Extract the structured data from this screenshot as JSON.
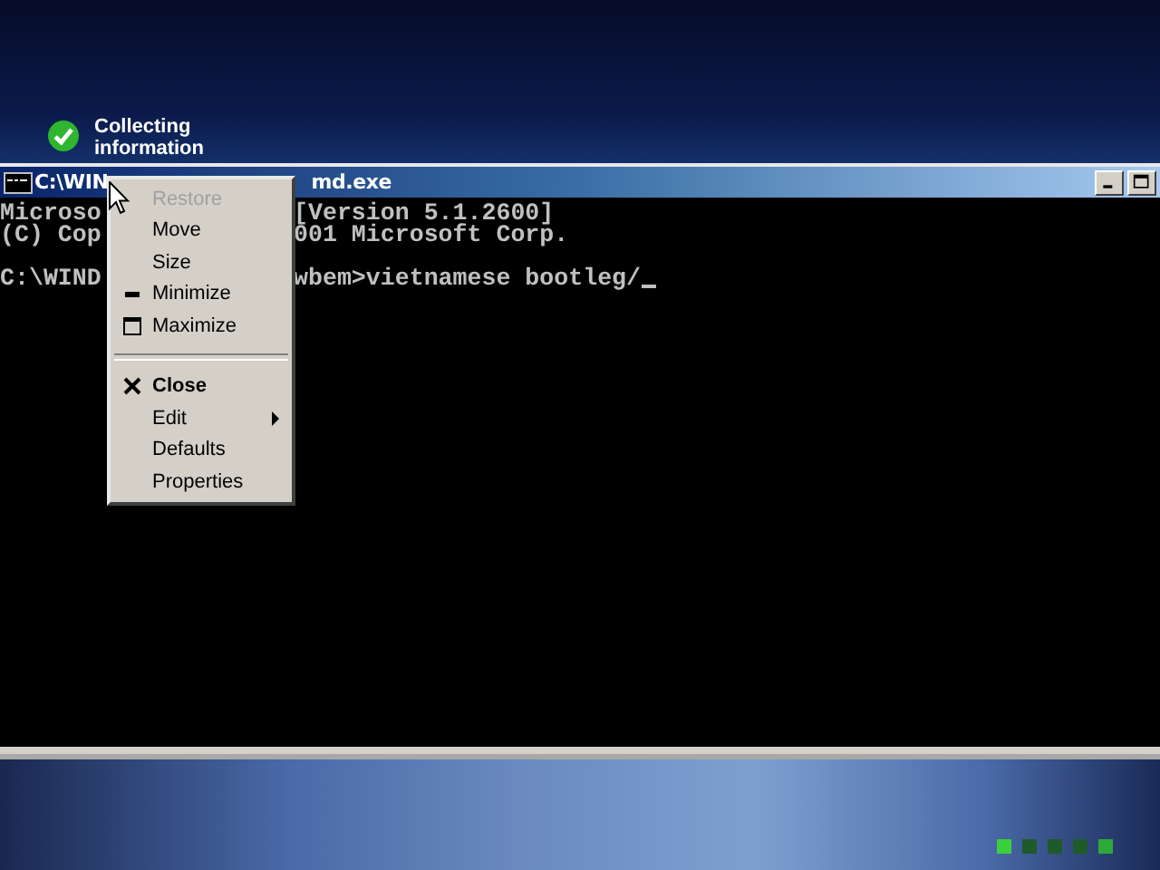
{
  "setup_status": {
    "text": "Collecting information"
  },
  "console_window": {
    "title_parts": [
      "C:\\WIN",
      "md.exe"
    ],
    "lines": [
      {
        "kind": "text",
        "left": "Microso",
        "right": "[Version 5.1.2600]"
      },
      {
        "kind": "text",
        "left": "(C) Cop",
        "right": "001 Microsoft Corp."
      },
      {
        "kind": "blank"
      },
      {
        "kind": "text",
        "left": "C:\\WIND",
        "right": "wbem>vietnamese bootleg/"
      }
    ]
  },
  "system_menu": {
    "items": [
      {
        "label": "Restore",
        "kind": "plain",
        "disabled": true,
        "default": false
      },
      {
        "label": "Move",
        "kind": "plain",
        "disabled": false,
        "default": false
      },
      {
        "label": "Size",
        "kind": "plain",
        "disabled": false,
        "default": false
      },
      {
        "label": "Minimize",
        "kind": "minimize",
        "disabled": false,
        "default": false
      },
      {
        "label": "Maximize",
        "kind": "maximize",
        "disabled": false,
        "default": false
      },
      {
        "kind": "separator"
      },
      {
        "label": "Close",
        "kind": "close",
        "disabled": false,
        "default": true
      },
      {
        "label": "Edit",
        "kind": "submenu",
        "disabled": false,
        "default": false
      },
      {
        "label": "Defaults",
        "kind": "plain",
        "disabled": false,
        "default": false
      },
      {
        "label": "Properties",
        "kind": "plain",
        "disabled": false,
        "default": false
      }
    ]
  }
}
